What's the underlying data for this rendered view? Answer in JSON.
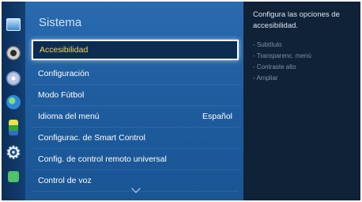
{
  "panel": {
    "title": "Sistema",
    "items": [
      {
        "label": "Accesibilidad",
        "value": ""
      },
      {
        "label": "Configuración",
        "value": ""
      },
      {
        "label": "Modo Fútbol",
        "value": ""
      },
      {
        "label": "Idioma del menú",
        "value": "Español"
      },
      {
        "label": "Configurac. de Smart Control",
        "value": ""
      },
      {
        "label": "Config. de control remoto universal",
        "value": ""
      },
      {
        "label": "Control de voz",
        "value": ""
      }
    ]
  },
  "description": {
    "text": "Configura las opciones de accesibilidad.",
    "options": [
      "Subtítulo",
      "Transparenc. menú",
      "Contraste alto",
      "Ampliar"
    ]
  },
  "rail_icons": [
    "tv-icon",
    "speaker-icon",
    "disc-icon",
    "globe-icon",
    "support-icon",
    "gear-icon",
    "apps-icon"
  ],
  "colors": {
    "panel_blue": "#2a6bb0",
    "selected_text": "#f3d75b",
    "description_bg": "#0f2238"
  }
}
